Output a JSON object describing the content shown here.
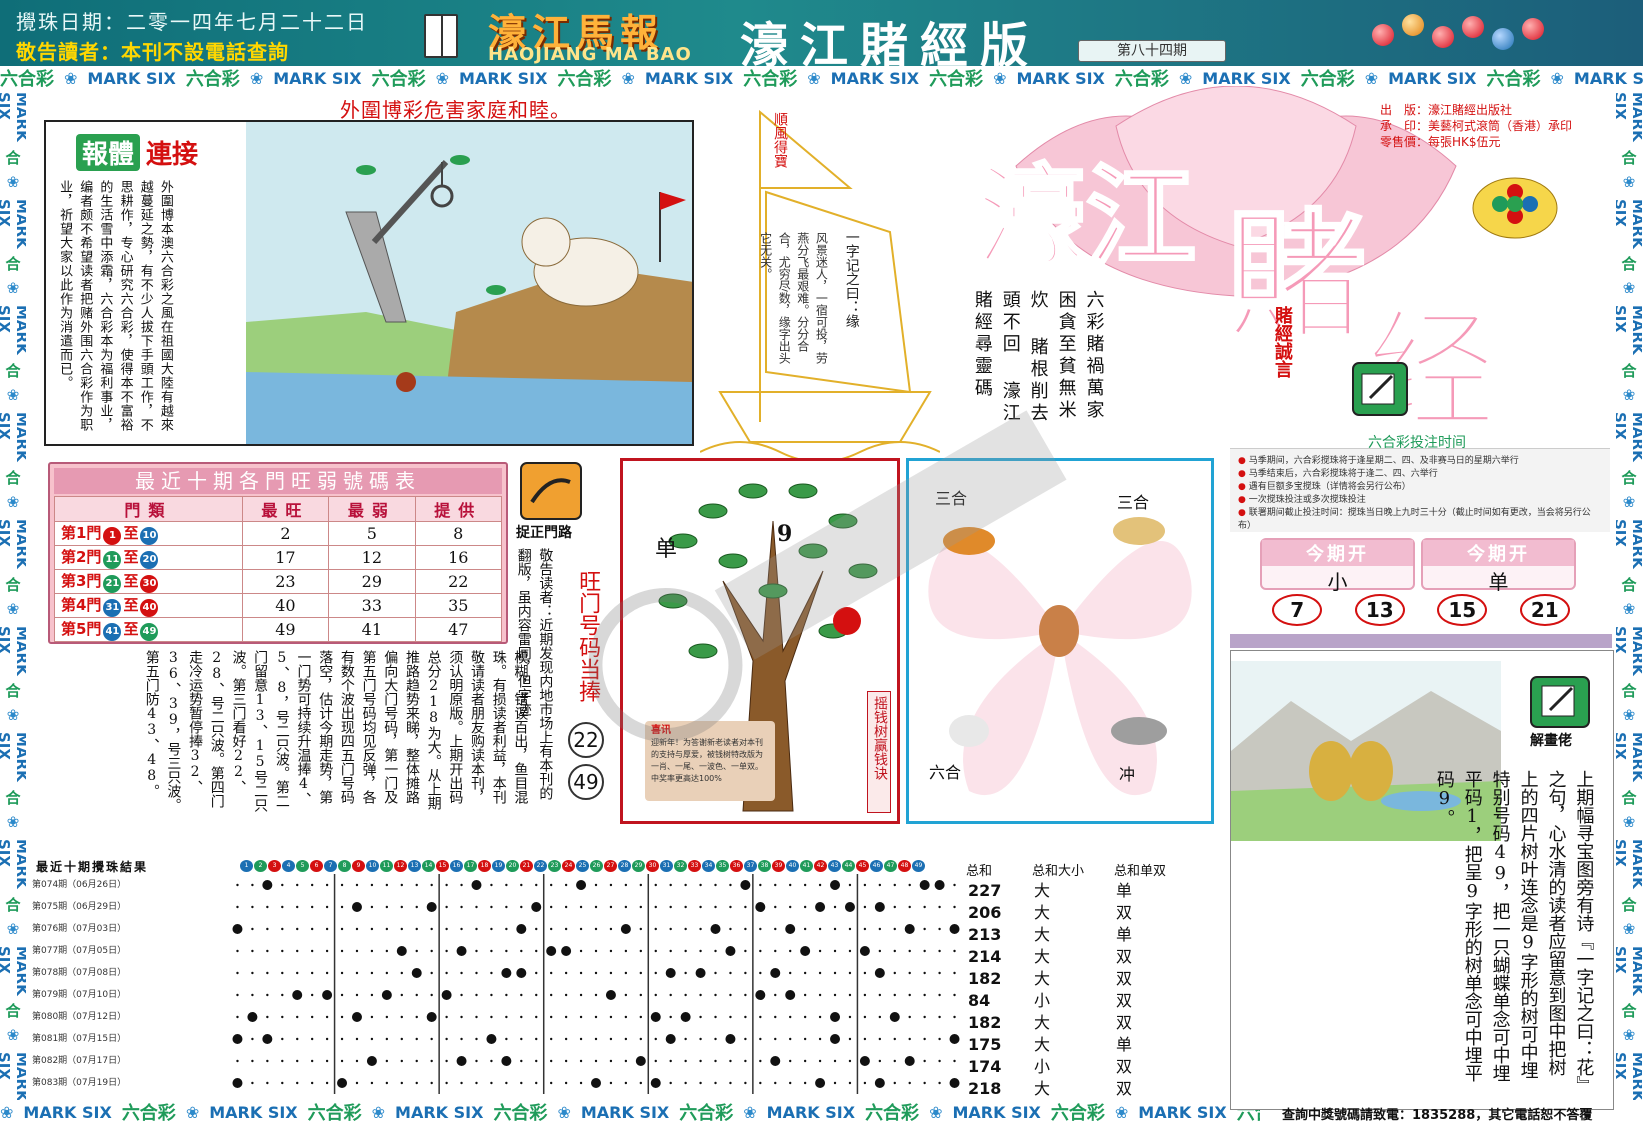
{
  "header": {
    "date": "攪珠日期：二零一四年七月二十二日",
    "warning": "敬告讀者：本刊不設電話查詢",
    "logo_cn": "濠江馬報",
    "logo_en": "HAOJIANG MA BAO",
    "title": "濠江賭經版",
    "issue": "第八十四期"
  },
  "border": {
    "lhc": "六合彩",
    "marksix": "MARK SIX",
    "flower": "❀"
  },
  "story": {
    "headline": "外圍博彩危害家庭和睦。",
    "label_box": "報體",
    "label_tail": "連接",
    "text": "外圍博本澳六合彩之風在祖國大陸有越來越蔓延之勢，有不少人拔下手頭工作，不思耕作，专心研究六合彩，使得本不富裕的生活雪中添霜，六合彩本为福利事业，编者颇不希望读者把赌外围六合彩作为职业，祈望大家以此作为消遣而已。"
  },
  "sailboat": {
    "flag": "順風得寶",
    "sail_text": "风景迷人，一宿可投，劳燕分飞最艰难。分分合合，尤穷尽数，缘字出头它无关。",
    "quote": "一字记之曰：缘"
  },
  "title_block": {
    "big1": "濠江",
    "big2": "賭",
    "big3": "经",
    "publisher": [
      "出　版：濠江賭經出版社",
      "承　印：美藝柯式滾筒（香港）承印",
      "零售價：每張HK$伍元"
    ],
    "verses": [
      "六彩賭禍萬家",
      "困貪至貧無米炊",
      "賭根削去頭不回",
      "濠江賭經尋靈碼"
    ],
    "motto": "賭經誠言",
    "lhc_time": "六合彩投注时间",
    "rules": [
      "马季期间，六合彩搅珠将于逢星期二、四、及非赛马日的星期六举行",
      "马季结束后，六合彩搅珠将于逢二、四、六举行",
      "遇有巨额多宝搅珠（详情将会另行公布）",
      "一次搅珠投注或多次搅珠投注",
      "联署期间截止投注时间：搅珠当日晚上九时三十分（截止时间如有更改，当会将另行公布）"
    ]
  },
  "this_issue": {
    "head": "今期开",
    "items": [
      "小",
      "单"
    ],
    "numbers": [
      "7",
      "13",
      "15",
      "21"
    ]
  },
  "door_table": {
    "title": "最近十期各門旺弱號碼表",
    "headers": [
      "門類",
      "最旺",
      "最弱",
      "提供"
    ],
    "rows": [
      {
        "door": "第1門",
        "from": "1",
        "to": "10",
        "c1": "#d41010",
        "c2": "#1b6fb3",
        "hot": "2",
        "cold": "5",
        "pick": "8"
      },
      {
        "door": "第2門",
        "from": "11",
        "to": "20",
        "c1": "#1f9b5a",
        "c2": "#1b6fb3",
        "hot": "17",
        "cold": "12",
        "pick": "16"
      },
      {
        "door": "第3門",
        "from": "21",
        "to": "30",
        "c1": "#1f9b5a",
        "c2": "#d41010",
        "hot": "23",
        "cold": "29",
        "pick": "22"
      },
      {
        "door": "第4門",
        "from": "31",
        "to": "40",
        "c1": "#1b6fb3",
        "c2": "#d41010",
        "hot": "40",
        "cold": "33",
        "pick": "35"
      },
      {
        "door": "第5門",
        "from": "41",
        "to": "49",
        "c1": "#1b6fb3",
        "c2": "#1f9b5a",
        "hot": "49",
        "cold": "41",
        "pick": "47"
      }
    ],
    "to_word": "至"
  },
  "analysis": {
    "text": "模糊，错误百出，鱼目混珠。有损读者利益，本刊敬请读者朋友购读本刊，须认明原版。上期开出码总分218为大。从上期推路趋势来睇，整体摊路偏向大门号码，第一门及第五门号码均见反弹，各有数个波出现四五门号码落空，估计今期走势，第一门势可持续升温捧4、5、8，号二只波。第二门留意13、15号二只波。第三门看好22、28、号二只波。第四门走冷运势暂停捧32、36、39，号三只波。第五门防43、48。"
  },
  "notice": {
    "icon_label": "捉正門路",
    "text": "敬告读者：近期发现内地市场上有本刊的翻版，虽内容雷同，但字迹",
    "hot_door": "旺门号码当捧",
    "hot_nums": [
      "22",
      "49"
    ]
  },
  "tree": {
    "left": "单",
    "top": "9",
    "side": "摇钱树赢钱诀",
    "note_title": "喜讯",
    "note_text": "迎新年！为答谢新老读者对本刊的支持与厚爱，被钱树特改版为一肖、一尾、一波色、一单双。中奖率更高达100%"
  },
  "zodiac": {
    "labels": [
      "三合",
      "三合",
      "六合",
      "冲"
    ]
  },
  "lower_art": {
    "label": "解畫佬",
    "text": "上期幅寻宝图旁有诗『一字记之曰：花』之句，心水清的读者应留意到图中把树上的四片树叶连念是9字形的树可中埋特别号码49，把一只蝴蝶单念可中埋平码1，把呈9字形的树单念可中埋平码9。"
  },
  "results": {
    "head": "最近十期攪珠結果",
    "col_sum": "总和",
    "col_size": "总和大小",
    "col_oe": "总和单双",
    "rows": [
      {
        "label": "第074期（06月26日）",
        "sum": "227",
        "size": "大",
        "oe": "单"
      },
      {
        "label": "第075期（06月29日）",
        "sum": "206",
        "size": "大",
        "oe": "双"
      },
      {
        "label": "第076期（07月03日）",
        "sum": "213",
        "size": "大",
        "oe": "单"
      },
      {
        "label": "第077期（07月05日）",
        "sum": "214",
        "size": "大",
        "oe": "双"
      },
      {
        "label": "第078期（07月08日）",
        "sum": "182",
        "size": "大",
        "oe": "双"
      },
      {
        "label": "第079期（07月10日）",
        "sum": "84",
        "size": "小",
        "oe": "双"
      },
      {
        "label": "第080期（07月12日）",
        "sum": "182",
        "size": "大",
        "oe": "双"
      },
      {
        "label": "第081期（07月15日）",
        "sum": "175",
        "size": "大",
        "oe": "单"
      },
      {
        "label": "第082期（07月17日）",
        "sum": "174",
        "size": "小",
        "oe": "双"
      },
      {
        "label": "第083期（07月19日）",
        "sum": "218",
        "size": "大",
        "oe": "双"
      }
    ],
    "draws": [
      [
        3,
        17,
        24,
        35,
        41,
        47,
        48
      ],
      [
        9,
        14,
        21,
        36,
        40,
        42,
        44
      ],
      [
        1,
        20,
        27,
        33,
        38,
        46,
        49
      ],
      [
        12,
        16,
        22,
        23,
        34,
        39,
        43
      ],
      [
        13,
        19,
        20,
        30,
        32,
        37,
        44
      ],
      [
        5,
        7,
        11,
        15,
        26,
        36,
        38
      ],
      [
        2,
        9,
        14,
        29,
        31,
        41,
        45
      ],
      [
        1,
        3,
        18,
        30,
        34,
        41,
        49
      ],
      [
        10,
        16,
        19,
        28,
        37,
        43,
        46
      ],
      [
        1,
        8,
        25,
        29,
        40,
        44,
        49
      ]
    ]
  },
  "footer": {
    "text": "查詢中獎號碼請致電：1835288，其它電話恕不答覆"
  },
  "colors": {
    "red": "#d41010",
    "green": "#1f9b5a",
    "blue": "#1b6fb3",
    "pink": "#f2bcd0"
  }
}
